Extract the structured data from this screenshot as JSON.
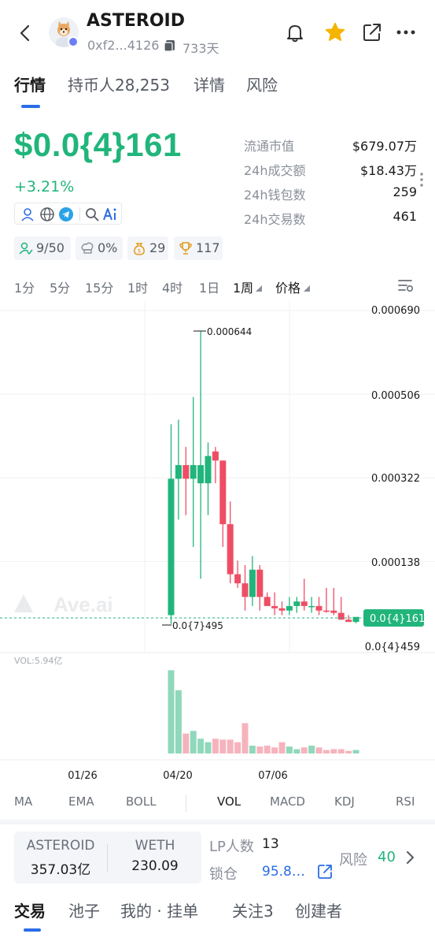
{
  "header": {
    "token_name": "ASTEROID",
    "address": "0xf2...4126",
    "age": "733天"
  },
  "tabs": [
    {
      "label": "行情",
      "active": true
    },
    {
      "label": "持币人28,253",
      "active": false
    },
    {
      "label": "详情",
      "active": false
    },
    {
      "label": "风险",
      "active": false
    }
  ],
  "price": {
    "value": "$0.0{4}161",
    "change": "+3.21%"
  },
  "stats": [
    {
      "label": "流通市值",
      "value": "$679.07万"
    },
    {
      "label": "24h成交额",
      "value": "$18.43万"
    },
    {
      "label": "24h钱包数",
      "value": "259"
    },
    {
      "label": "24h交易数",
      "value": "461"
    }
  ],
  "chips": [
    {
      "icon": "user-check-icon",
      "value": "9/50"
    },
    {
      "icon": "chef-hat-icon",
      "value": "0%"
    },
    {
      "icon": "money-bag-icon",
      "value": "29"
    },
    {
      "icon": "trophy-icon",
      "value": "117"
    }
  ],
  "intervals": [
    {
      "label": "1分",
      "active": false
    },
    {
      "label": "5分",
      "active": false
    },
    {
      "label": "15分",
      "active": false
    },
    {
      "label": "1时",
      "active": false
    },
    {
      "label": "4时",
      "active": false
    },
    {
      "label": "1日",
      "active": false
    },
    {
      "label": "1周",
      "active": true
    },
    {
      "label": "价格",
      "active": true
    }
  ],
  "chart_data": {
    "type": "candlestick",
    "y_ticks": [
      "0.000690",
      "0.000506",
      "0.000322",
      "0.000138"
    ],
    "high_label": "0.000644",
    "low_label": "0.0{7}495",
    "current_price_label": "0.0{4}161",
    "bottom_label": "0.0{4}459",
    "vol_label": "VOL:5.94亿",
    "x_labels": [
      "01/26",
      "04/20",
      "07/06"
    ],
    "watermark": "Ave.ai",
    "candles": [
      {
        "o": 2e-05,
        "h": 0.00044,
        "l": 5e-07,
        "c": 0.00032,
        "up": true
      },
      {
        "o": 0.00032,
        "h": 0.00045,
        "l": 0.00023,
        "c": 0.00035,
        "up": true
      },
      {
        "o": 0.00035,
        "h": 0.00039,
        "l": 0.00024,
        "c": 0.00032,
        "up": false
      },
      {
        "o": 0.00032,
        "h": 0.0005,
        "l": 0.00017,
        "c": 0.00035,
        "up": true
      },
      {
        "o": 0.00035,
        "h": 0.000644,
        "l": 0.0001,
        "c": 0.00031,
        "up": true
      },
      {
        "o": 0.00031,
        "h": 0.0004,
        "l": 0.00024,
        "c": 0.00037,
        "up": true
      },
      {
        "o": 0.00038,
        "h": 0.00039,
        "l": 0.00031,
        "c": 0.00036,
        "up": false
      },
      {
        "o": 0.00036,
        "h": 0.00036,
        "l": 0.00017,
        "c": 0.00022,
        "up": false
      },
      {
        "o": 0.00022,
        "h": 0.00027,
        "l": 9e-05,
        "c": 0.00011,
        "up": false
      },
      {
        "o": 0.00011,
        "h": 0.00014,
        "l": 8e-05,
        "c": 9e-05,
        "up": false
      },
      {
        "o": 9e-05,
        "h": 0.00013,
        "l": 3e-05,
        "c": 6e-05,
        "up": false
      },
      {
        "o": 6e-05,
        "h": 0.00015,
        "l": 4e-05,
        "c": 0.00012,
        "up": true
      },
      {
        "o": 0.00012,
        "h": 0.00013,
        "l": 3e-05,
        "c": 6e-05,
        "up": false
      },
      {
        "o": 6e-05,
        "h": 7e-05,
        "l": 4e-05,
        "c": 4e-05,
        "up": false
      },
      {
        "o": 4e-05,
        "h": 7e-05,
        "l": 2e-05,
        "c": 3.5e-05,
        "up": false
      },
      {
        "o": 3.5e-05,
        "h": 5e-05,
        "l": 2e-05,
        "c": 3e-05,
        "up": false
      },
      {
        "o": 3e-05,
        "h": 6e-05,
        "l": 2e-05,
        "c": 4e-05,
        "up": true
      },
      {
        "o": 4e-05,
        "h": 6e-05,
        "l": 2.5e-05,
        "c": 5e-05,
        "up": true
      },
      {
        "o": 5e-05,
        "h": 0.0001,
        "l": 3e-05,
        "c": 4e-05,
        "up": false
      },
      {
        "o": 4e-05,
        "h": 6e-05,
        "l": 2.5e-05,
        "c": 4e-05,
        "up": true
      },
      {
        "o": 4e-05,
        "h": 6e-05,
        "l": 2e-05,
        "c": 3e-05,
        "up": false
      },
      {
        "o": 3e-05,
        "h": 8e-05,
        "l": 2.5e-05,
        "c": 3e-05,
        "up": false
      },
      {
        "o": 3e-05,
        "h": 8e-05,
        "l": 2e-05,
        "c": 2.5e-05,
        "up": false
      },
      {
        "o": 2.5e-05,
        "h": 6e-05,
        "l": 1e-05,
        "c": 1e-05,
        "up": false
      },
      {
        "o": 1e-05,
        "h": 2e-05,
        "l": 5e-06,
        "c": 5e-06,
        "up": false
      },
      {
        "o": 5e-06,
        "h": 1e-05,
        "l": 2e-06,
        "c": 1.61e-05,
        "up": true
      }
    ],
    "volumes": [
      0.96,
      0.73,
      0.23,
      0.26,
      0.17,
      0.13,
      0.17,
      0.16,
      0.16,
      0.13,
      0.35,
      0.09,
      0.08,
      0.09,
      0.07,
      0.13,
      0.08,
      0.05,
      0.07,
      0.09,
      0.07,
      0.04,
      0.05,
      0.05,
      0.03,
      0.04
    ]
  },
  "indicators": [
    {
      "label": "MA",
      "active": false
    },
    {
      "label": "EMA",
      "active": false
    },
    {
      "label": "BOLL",
      "active": false
    },
    {
      "label": "VOL",
      "active": true
    },
    {
      "label": "MACD",
      "active": false
    },
    {
      "label": "KDJ",
      "active": false
    },
    {
      "label": "RSI",
      "active": false
    }
  ],
  "pool": {
    "token_a": "ASTEROID",
    "amount_a": "357.03亿",
    "token_b": "WETH",
    "amount_b": "230.09"
  },
  "lp": {
    "lp_label": "LP人数",
    "lp_value": "13",
    "lock_label": "锁仓",
    "lock_value": "95.8…",
    "risk_label": "风险",
    "risk_value": "40"
  },
  "bottom_tabs": [
    {
      "label": "交易",
      "active": true
    },
    {
      "label": "池子",
      "active": false
    },
    {
      "label": "我的 · 挂单",
      "active": false
    },
    {
      "label": "关注3",
      "active": false
    },
    {
      "label": "创建者",
      "active": false
    }
  ],
  "colors": {
    "up": "#21b57b",
    "down": "#ef4d64",
    "accent": "#2b6de6",
    "star": "#f5b400"
  }
}
